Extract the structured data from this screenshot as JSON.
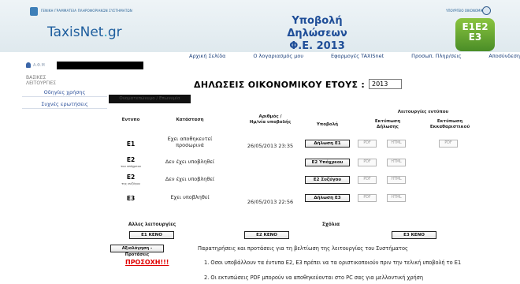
{
  "header": {
    "gov_text": "ΓΕΝΙΚΗ ΓΡΑΜΜΑΤΕΙΑ ΠΛΗΡΟΦΟΡΙΑΚΩΝ ΣΥΣΤΗΜΑΤΩΝ",
    "logo_main": "TaxisNet",
    "logo_dot": ".",
    "logo_tld": "gr",
    "title_line1": "Υποβολή Δηλώσεων",
    "title_line2": "Φ.Ε. 2013",
    "ministry_text": "ΥΠΟΥΡΓΕΙΟ ΟΙΚΟΝΟΜΙΚΩΝ",
    "badge_line1": "E1E2",
    "badge_line2": "E3"
  },
  "topnav": [
    "Αρχική Σελίδα",
    "Ο λογαριασμός μου",
    "Εφαρμογές TAXISnet",
    "Προσωπ. Πληρ/σεις",
    "Αποσύνδεση"
  ],
  "sidebar": {
    "afm_label": "Α.Φ.Μ",
    "title_line1": "ΒΑΣΙΚΕΣ",
    "title_line2": "ΛΕΙΤΟΥΡΓΙΕΣ",
    "links": [
      "Οδηγίες χρήσης",
      "Συχνές ερωτήσεις"
    ]
  },
  "main": {
    "title": "ΔΗΛΩΣΕΙΣ ΟΙΚΟΝΟΜΙΚΟΥ ΕΤΟΥΣ :",
    "year": "2013",
    "banner": "Ονοματεπώνυμο / Επωνυμία",
    "columns": {
      "form": "Εντυπο",
      "status": "Κατάσταση",
      "number_line1": "Αριθμός /",
      "number_line2": "Ημ/νία υποβολής",
      "submit": "Υποβολή",
      "print_group": "Λειτουργίες εντύπου",
      "print_decl_line1": "Εκτύπωση",
      "print_decl_line2": "Δήλωσης",
      "print_notice_line1": "Εκτύπωση",
      "print_notice_line2": "Εκκαθαριστικού"
    },
    "rows": [
      {
        "code": "E1",
        "sub": "",
        "status_line1": "Εχει αποθηκευτεί",
        "status_line2": "προσωρινά",
        "date": "26/05/2013 23:35",
        "submit": "Δήλωση Ε1",
        "pdf": "PDF",
        "html": "HTML",
        "notice_pdf": "PDF"
      },
      {
        "code": "E2",
        "sub": "του υπόχρεου",
        "status_line1": "Δεν έχει υποβληθεί",
        "status_line2": "",
        "date": "",
        "submit": "Ε2 Υπόχρεου",
        "pdf": "PDF",
        "html": "HTML",
        "notice_pdf": ""
      },
      {
        "code": "E2",
        "sub": "της συζύγου",
        "status_line1": "Δεν έχει υποβληθεί",
        "status_line2": "",
        "date": "",
        "submit": "Ε2 Συζύγου",
        "pdf": "PDF",
        "html": "HTML",
        "notice_pdf": ""
      },
      {
        "code": "E3",
        "sub": "",
        "status_line1": "Εχει υποβληθεί",
        "status_line2": "",
        "date": "26/05/2013 22:56",
        "submit": "Δήλωση Ε3",
        "pdf": "PDF",
        "html": "HTML",
        "notice_pdf": ""
      }
    ],
    "other_functions": "Αλλες λειτουργίες",
    "comments": "Σχόλια",
    "blank_buttons": [
      "Ε1 ΚΕΝΟ",
      "Ε2 ΚΕΝΟ",
      "Ε3 ΚΕΝΟ"
    ],
    "feedback_button": "Αξιολόγηση - Προτάσεις",
    "feedback_text": "Παρατηρήσεις και προτάσεις για τη βελτίωση της λειτουργίας του Συστήματος",
    "attention": "ΠΡΟΣΟΧΗ!!!",
    "notes": [
      "1. Οσοι υποβάλλουν τα έντυπα Ε2, Ε3 πρέπει να τα οριστικοποιούν πριν την τελική υποβολή το Ε1",
      "2. Οι εκτυπώσεις PDF μπορούν να αποθηκεύονται στο PC σας για μελλοντική χρήση"
    ]
  }
}
